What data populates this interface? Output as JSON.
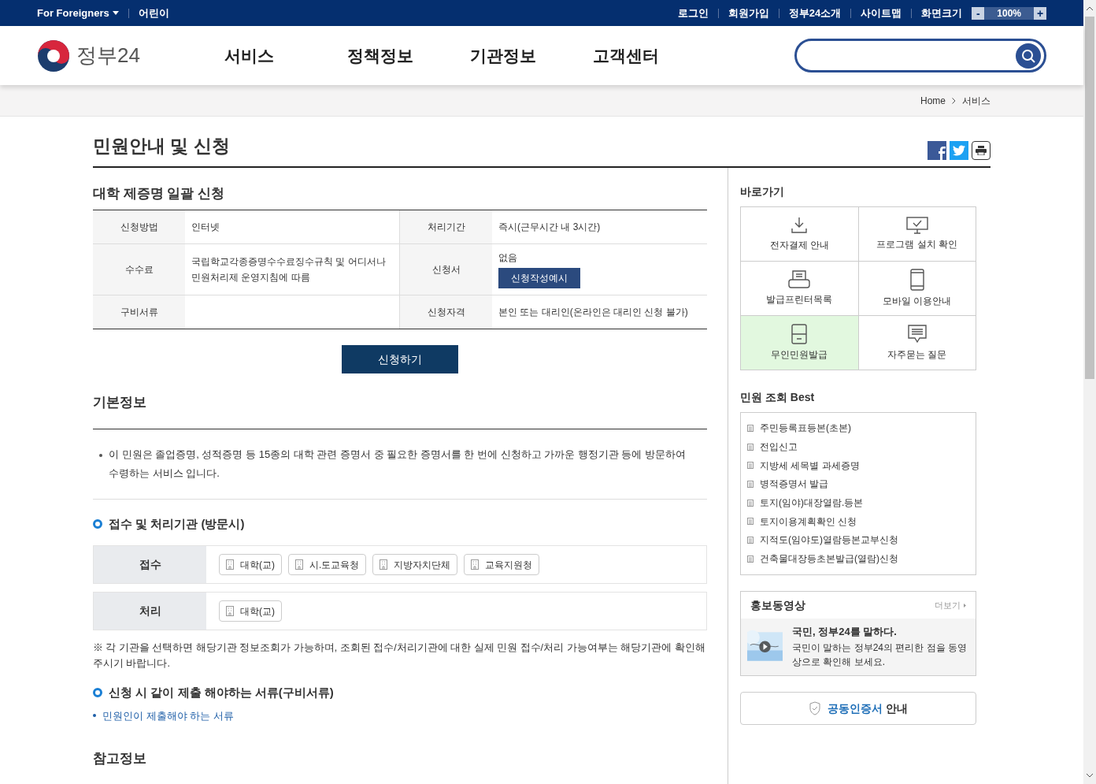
{
  "utility_bar": {
    "left": [
      {
        "label": "For Foreigners",
        "dropdown": true
      },
      {
        "label": "어린이",
        "dropdown": false
      }
    ],
    "right": [
      "로그인",
      "회원가입",
      "정부24소개",
      "사이트맵"
    ],
    "zoom": {
      "label": "화면크기",
      "minus": "-",
      "value": "100%",
      "plus": "+"
    }
  },
  "header": {
    "logo": "정부24",
    "nav": [
      "서비스",
      "정책정보",
      "기관정보",
      "고객센터"
    ]
  },
  "breadcrumb": [
    "Home",
    "서비스"
  ],
  "page_title": "민원안내 및 신청",
  "service": {
    "title": "대학 제증명 일괄 신청",
    "rows": [
      {
        "label1": "신청방법",
        "value1": "인터넷",
        "label2": "처리기간",
        "value2": "즉시(근무시간 내 3시간)"
      },
      {
        "label1": "수수료",
        "value1": "국립학교각종증명수수료징수규칙 및 어디서나 민원처리제 운영지침에 따름",
        "label2": "신청서",
        "value2": "없음",
        "button": "신청작성예시"
      },
      {
        "label1": "구비서류",
        "value1": "",
        "label2": "신청자격",
        "value2": "본인 또는 대리인(온라인은 대리인 신청 불가)"
      }
    ],
    "apply_button": "신청하기"
  },
  "basic_info": {
    "title": "기본정보",
    "description": "이 민원은 졸업증명, 성적증명 등 15종의 대학 관련 증명서 중 필요한 증명서를 한 번에 신청하고 가까운 행정기관 등에 방문하여 수령하는 서비스 입니다.",
    "agency_title": "접수 및 처리기관 (방문시)",
    "agency_rows": [
      {
        "label": "접수",
        "agencies": [
          "대학(교)",
          "시.도교육청",
          "지방자치단체",
          "교육지원청"
        ]
      },
      {
        "label": "처리",
        "agencies": [
          "대학(교)"
        ]
      }
    ],
    "note": "※ 각 기관을 선택하면 해당기관 정보조회가 가능하며, 조회된 접수/처리기관에 대한 실제 민원 접수/처리 가능여부는 해당기관에 확인해 주시기 바랍니다.",
    "documents_title": "신청 시 같이 제출 해야하는 서류(구비서류)",
    "documents_link": "민원인이 제출해야 하는 서류"
  },
  "reference": {
    "title": "참고정보"
  },
  "sidebar": {
    "quick_title": "바로가기",
    "quick_links": [
      {
        "label": "전자결제 안내",
        "highlighted": false
      },
      {
        "label": "프로그램 설치 확인",
        "highlighted": false
      },
      {
        "label": "발급프린터목록",
        "highlighted": false
      },
      {
        "label": "모바일 이용안내",
        "highlighted": false
      },
      {
        "label": "무인민원발급",
        "highlighted": true
      },
      {
        "label": "자주묻는 질문",
        "highlighted": false
      }
    ],
    "best_title": "민원 조회 Best",
    "best": [
      "주민등록표등본(초본)",
      "전입신고",
      "지방세 세목별 과세증명",
      "병적증명서 발급",
      "토지(임야)대장열람.등본",
      "토지이용계획확인 신청",
      "지적도(임야도)열람등본교부신청",
      "건축물대장등초본발급(열람)신청"
    ],
    "video": {
      "title": "홍보동영상",
      "more": "더보기",
      "headline": "국민, 정부24를 말하다.",
      "text": "국민이 말하는 정부24의 편리한 점을 동영상으로 확인해 보세요."
    },
    "cert": {
      "highlight": "공동인증서",
      "text": "안내"
    }
  }
}
